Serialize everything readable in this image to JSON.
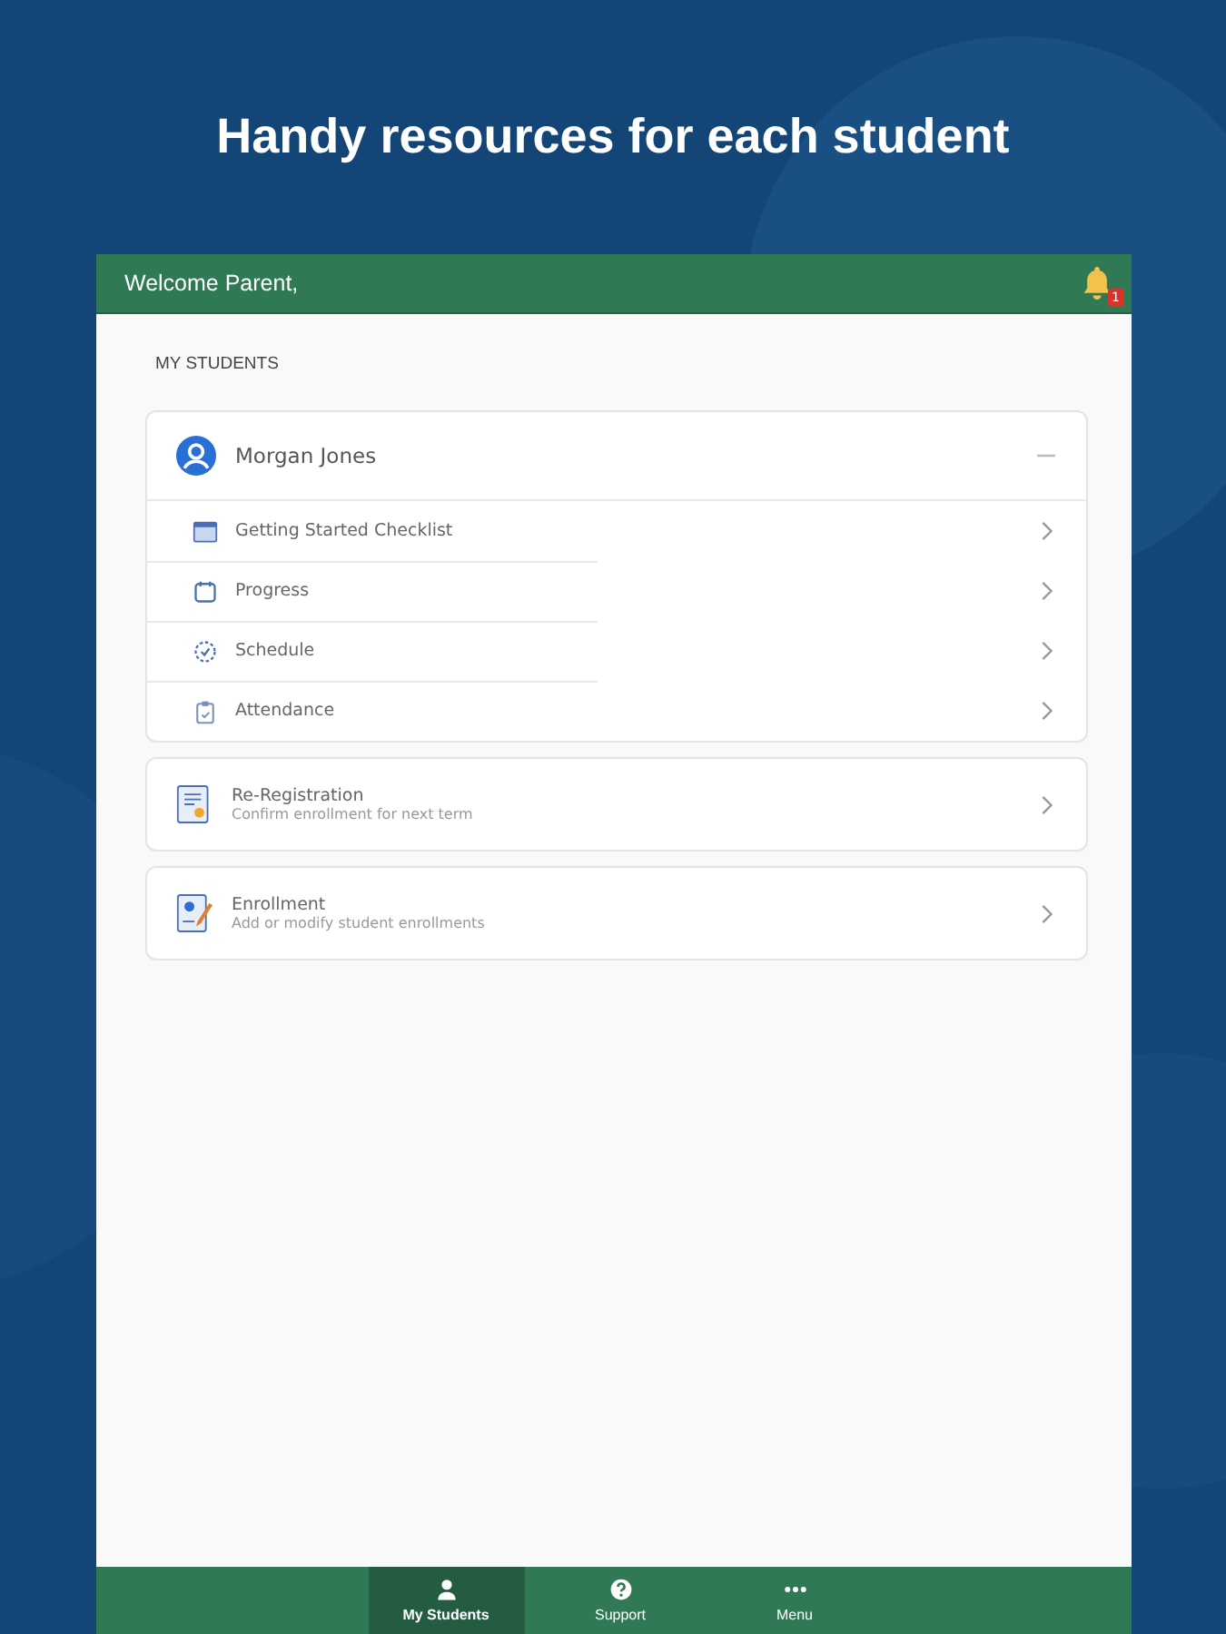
{
  "headline": "Handy resources for each student",
  "header": {
    "greeting": "Welcome Parent,",
    "notification_count": "1"
  },
  "section_title": "MY STUDENTS",
  "student": {
    "name": "Morgan Jones",
    "expanded": true,
    "items": [
      {
        "label": "Getting Started Checklist",
        "kind": "checklist"
      },
      {
        "label": "Progress",
        "kind": "progress"
      },
      {
        "label": "Schedule",
        "kind": "schedule"
      },
      {
        "label": "Attendance",
        "kind": "attendance"
      }
    ]
  },
  "cards": [
    {
      "title": "Re-Registration",
      "subtitle": "Confirm enrollment for next term",
      "kind": "reregistration"
    },
    {
      "title": "Enrollment",
      "subtitle": "Add or modify student enrollments",
      "kind": "enrollment"
    }
  ],
  "nav": [
    {
      "label": "My Students",
      "kind": "person",
      "selected": true
    },
    {
      "label": "Support",
      "kind": "help",
      "selected": false
    },
    {
      "label": "Menu",
      "kind": "dots",
      "selected": false
    }
  ]
}
